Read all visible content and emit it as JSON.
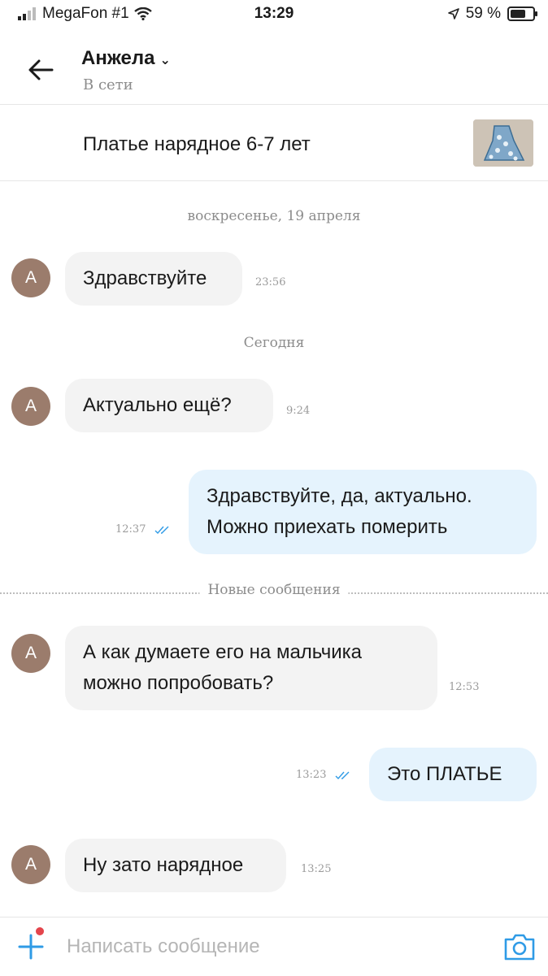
{
  "status_bar": {
    "carrier": "MegaFon #1",
    "time": "13:29",
    "battery": "59 %",
    "battery_level": 0.59
  },
  "header": {
    "contact_name": "Анжела",
    "contact_status": "В сети"
  },
  "listing": {
    "title": "Платье нарядное 6-7 лет"
  },
  "chat": {
    "date_1": "воскресенье, 19 апреля",
    "date_2": "Сегодня",
    "new_messages_label": "Новые сообщения",
    "messages": [
      {
        "direction": "in",
        "avatar": "А",
        "lines": [
          "Здравствуйте"
        ],
        "time": "23:56"
      },
      {
        "direction": "in",
        "avatar": "А",
        "lines": [
          "Актуально ещё?"
        ],
        "time": "9:24"
      },
      {
        "direction": "out",
        "lines": [
          "Здравствуйте, да, актуально.",
          "Можно приехать померить"
        ],
        "time": "12:37"
      },
      {
        "direction": "in",
        "avatar": "А",
        "lines": [
          "А как думаете его на мальчика",
          "можно попробовать?"
        ],
        "time": "12:53"
      },
      {
        "direction": "out",
        "lines": [
          "Это ПЛАТЬЕ"
        ],
        "time": "13:23"
      },
      {
        "direction": "in",
        "avatar": "А",
        "lines": [
          "Ну зато нарядное"
        ],
        "time": "13:25"
      }
    ]
  },
  "input": {
    "placeholder": "Написать сообщение"
  },
  "colors": {
    "accent": "#2f9be6",
    "incoming_bubble": "#f3f3f3",
    "outgoing_bubble": "#e5f3fd",
    "avatar": "#9b7c6c",
    "notification_dot": "#e4454c"
  }
}
